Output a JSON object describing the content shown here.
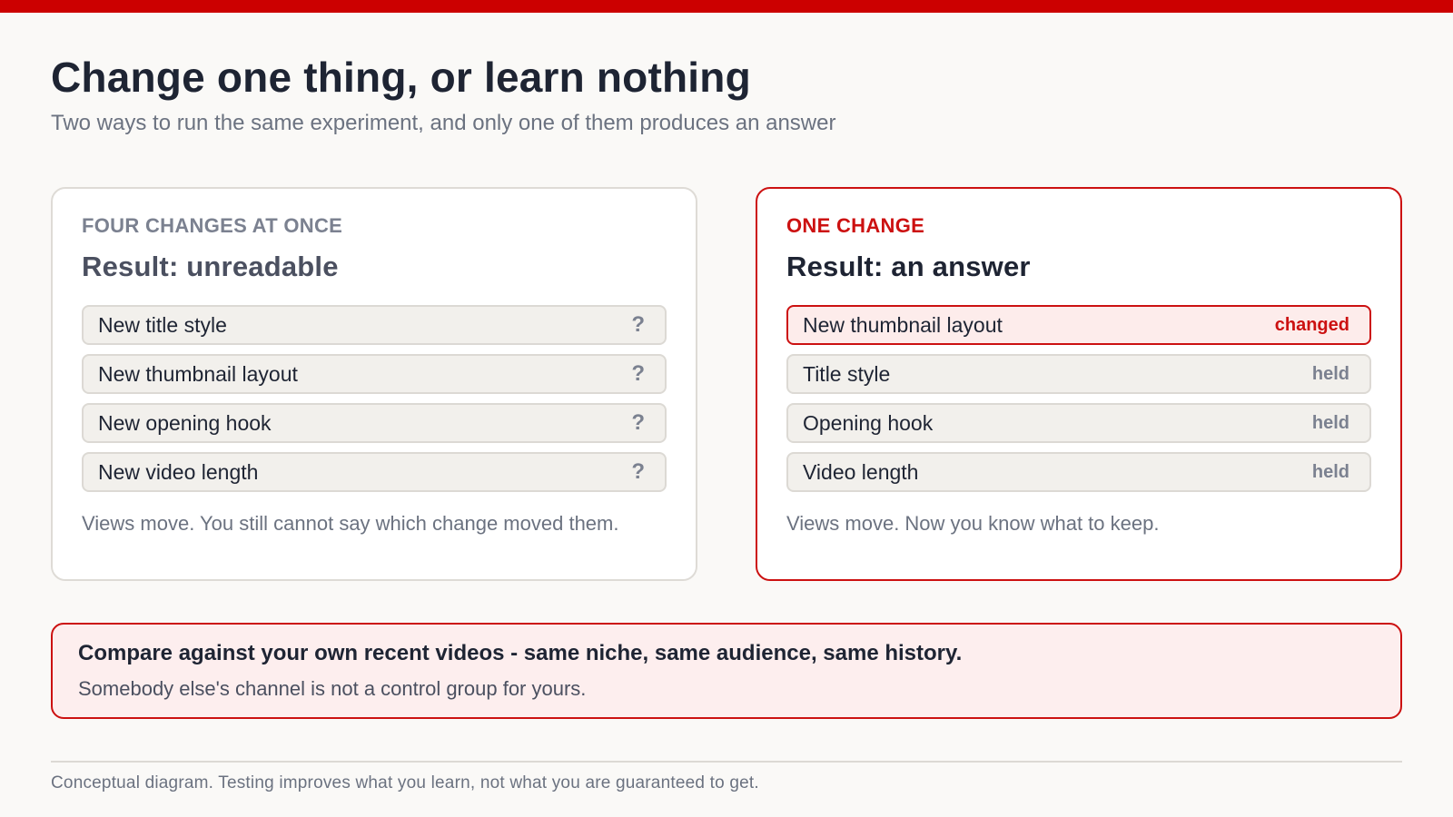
{
  "header": {
    "title": "Change one thing, or learn nothing",
    "subtitle": "Two ways to run the same experiment, and only one of them produces an answer"
  },
  "left_panel": {
    "kicker": "FOUR CHANGES AT ONCE",
    "result": "Result: unreadable",
    "rows": [
      {
        "label": "New title style",
        "tag": "?"
      },
      {
        "label": "New thumbnail layout",
        "tag": "?"
      },
      {
        "label": "New opening hook",
        "tag": "?"
      },
      {
        "label": "New video length",
        "tag": "?"
      }
    ],
    "note": "Views move. You still cannot say which change moved them."
  },
  "right_panel": {
    "kicker": "ONE CHANGE",
    "result": "Result: an answer",
    "rows": [
      {
        "label": "New thumbnail layout",
        "tag": "changed"
      },
      {
        "label": "Title style",
        "tag": "held"
      },
      {
        "label": "Opening hook",
        "tag": "held"
      },
      {
        "label": "Video length",
        "tag": "held"
      }
    ],
    "note": "Views move. Now you know what to keep."
  },
  "callout": {
    "headline": "Compare against your own recent videos - same niche, same audience, same history.",
    "body": "Somebody else's channel is not a control group for yours."
  },
  "footnote": "Conceptual diagram. Testing improves what you learn, not what you are guaranteed to get.",
  "colors": {
    "accent": "#cc0000",
    "background": "#faf9f7",
    "text": "#1e2433",
    "muted": "#6b7280"
  }
}
